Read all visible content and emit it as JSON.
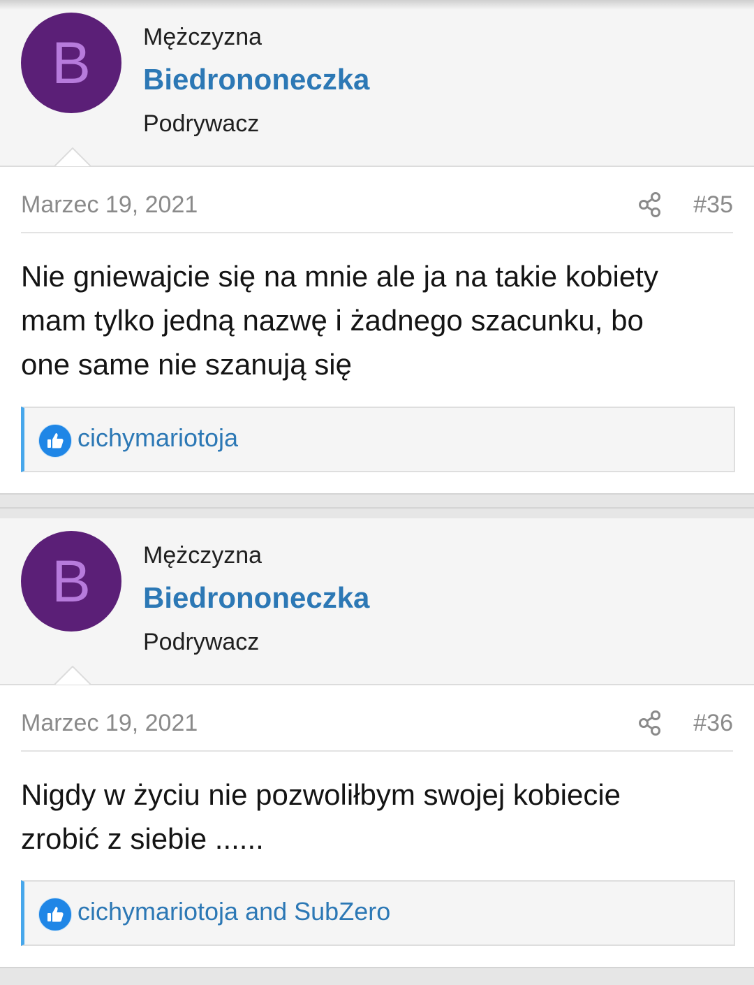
{
  "posts": [
    {
      "avatar_letter": "B",
      "gender": "Mężczyzna",
      "username": "Biedrononeczka",
      "user_title": "Podrywacz",
      "date": "Marzec 19, 2021",
      "number": "#35",
      "body_lines": [
        "Nie gniewajcie się na mnie ale ja na takie kobiety",
        "mam tylko jedną nazwę i żadnego szacunku, bo",
        "one same nie szanują się"
      ],
      "reactions": "cichymariotoja"
    },
    {
      "avatar_letter": "B",
      "gender": "Mężczyzna",
      "username": "Biedrononeczka",
      "user_title": "Podrywacz",
      "date": "Marzec 19, 2021",
      "number": "#36",
      "body_lines": [
        "Nigdy w życiu nie pozwoliłbym swojej kobiecie",
        "zrobić z siebie ......"
      ],
      "reactions": "cichymariotoja and SubZero"
    }
  ],
  "icons": {
    "share": "share-icon",
    "reaction": "like-icon"
  },
  "colors": {
    "accent": "#2c78b5",
    "avatar_bg": "#5b1f77",
    "avatar_letter": "#b77bdc",
    "reaction_bar": "#47a7eb"
  }
}
